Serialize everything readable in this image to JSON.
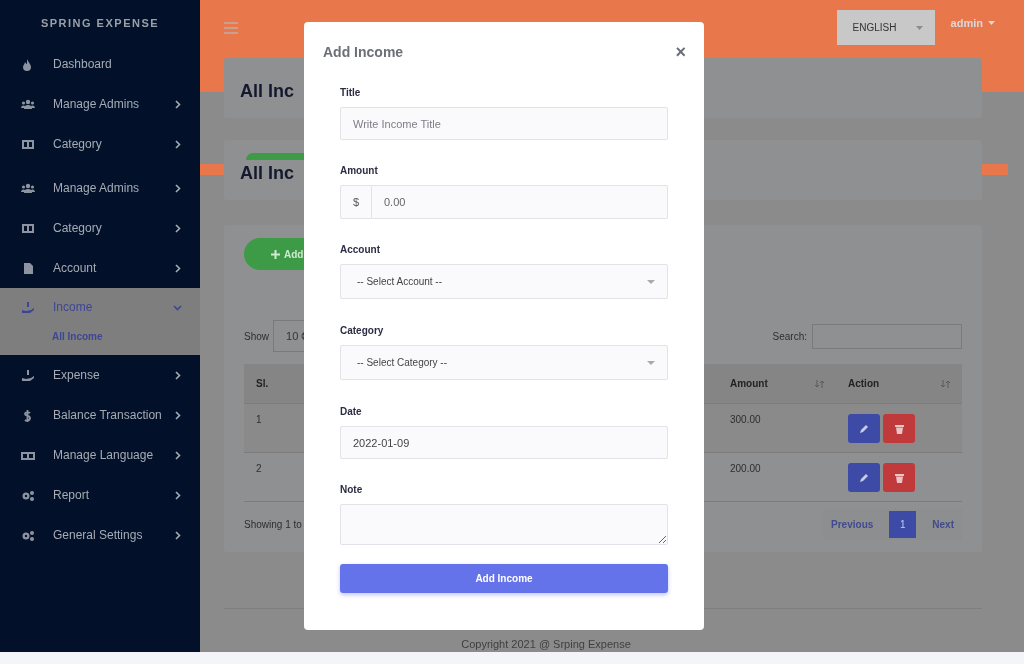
{
  "sidebar": {
    "brand": "SPRING EXPENSE",
    "items": [
      {
        "label": "Dashboard",
        "selected": false
      },
      {
        "label": "Manage Admins",
        "selected": false,
        "expanded": false
      },
      {
        "label": "Category",
        "selected": false,
        "expanded": false
      },
      {
        "label": "Manage Admins",
        "selected": false,
        "expanded": false
      },
      {
        "label": "Category",
        "selected": false,
        "expanded": false
      },
      {
        "label": "Account",
        "selected": false,
        "expanded": false
      },
      {
        "label": "Income",
        "selected": true,
        "expanded": true,
        "children": [
          {
            "label": "All Income",
            "selected": true
          }
        ]
      },
      {
        "label": "Expense",
        "selected": false,
        "expanded": false
      },
      {
        "label": "Balance Transaction",
        "selected": false,
        "expanded": false
      },
      {
        "label": "Manage Language",
        "selected": false,
        "expanded": false
      },
      {
        "label": "Report",
        "selected": false,
        "expanded": false
      },
      {
        "label": "General Settings",
        "selected": false,
        "expanded": false
      }
    ]
  },
  "header": {
    "language": "ENGLISH",
    "user": "admin"
  },
  "page_cards": [
    {
      "title": "All Inc"
    },
    {
      "title": "All Inc"
    }
  ],
  "list_card": {
    "add_button": "Add",
    "show_label": "Show",
    "page_size": "10",
    "search_label": "Search:",
    "table": {
      "columns": [
        {
          "label": "Sl."
        },
        {
          "label": "Amount",
          "sortable": true
        },
        {
          "label": "Action",
          "sortable": true
        }
      ],
      "rows": [
        {
          "sl": "1",
          "amount": "300.00"
        },
        {
          "sl": "2",
          "amount": "200.00"
        }
      ]
    },
    "info": "Showing 1 to",
    "pagination": {
      "previous": "Previous",
      "pages": [
        {
          "label": "1",
          "selected": true
        }
      ],
      "next": "Next"
    }
  },
  "footer": "Copyright 2021 @ Srping Expense",
  "modal": {
    "title": "Add Income",
    "close": "×",
    "fields": [
      {
        "kind": "text",
        "label": "Title",
        "placeholder": "Write Income Title"
      },
      {
        "kind": "money",
        "label": "Amount",
        "prefix": "$",
        "placeholder": "0.00"
      },
      {
        "kind": "select",
        "label": "Account",
        "value": "-- Select Account --"
      },
      {
        "kind": "select",
        "label": "Category",
        "value": "-- Select Category --"
      },
      {
        "kind": "text",
        "label": "Date",
        "value": "2022-01-09"
      },
      {
        "kind": "textarea",
        "label": "Note"
      }
    ],
    "submit": "Add Income"
  }
}
